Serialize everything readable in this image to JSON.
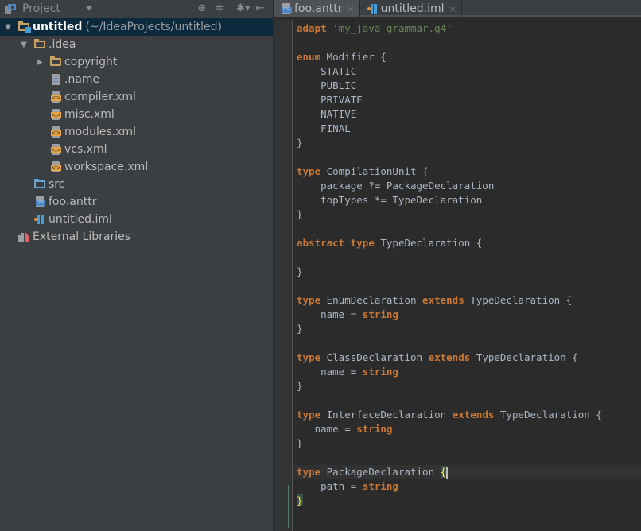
{
  "project_panel": {
    "title": "Project",
    "toolbar_icons": [
      "locate-icon",
      "collapse-all-icon",
      "settings-icon",
      "hide-panel-icon"
    ],
    "tree": [
      {
        "label": "untitled",
        "suffix": "(~/IdeaProjects/untitled)",
        "icon": "module-folder-icon",
        "expanded": true,
        "selected": true,
        "level": 0
      },
      {
        "label": ".idea",
        "icon": "folder-icon",
        "expanded": true,
        "level": 1
      },
      {
        "label": "copyright",
        "icon": "folder-icon",
        "expanded": false,
        "level": 2
      },
      {
        "label": ".name",
        "icon": "text-file-icon",
        "level": 2
      },
      {
        "label": "compiler.xml",
        "icon": "xml-file-icon",
        "level": 2
      },
      {
        "label": "misc.xml",
        "icon": "xml-file-icon",
        "level": 2
      },
      {
        "label": "modules.xml",
        "icon": "xml-file-icon",
        "level": 2
      },
      {
        "label": "vcs.xml",
        "icon": "xml-file-icon",
        "level": 2
      },
      {
        "label": "workspace.xml",
        "icon": "xml-file-icon",
        "level": 2
      },
      {
        "label": "src",
        "icon": "source-folder-icon",
        "level": 1
      },
      {
        "label": "foo.anttr",
        "icon": "dsl-file-icon",
        "level": 1
      },
      {
        "label": "untitled.iml",
        "icon": "iml-file-icon",
        "level": 1
      },
      {
        "label": "External Libraries",
        "icon": "libraries-icon",
        "level": 0
      }
    ]
  },
  "editor": {
    "tabs": [
      {
        "label": "foo.anttr",
        "active": true,
        "close": "×"
      },
      {
        "label": "untitled.iml",
        "active": false,
        "close": "×"
      }
    ],
    "code_lines": [
      [
        {
          "t": "adapt",
          "c": "kw"
        },
        {
          "t": " "
        },
        {
          "t": "'my_java-grammar.g4'",
          "c": "str"
        }
      ],
      [],
      [
        {
          "t": "enum",
          "c": "kw"
        },
        {
          "t": " Modifier {"
        }
      ],
      [
        {
          "t": "    STATIC"
        }
      ],
      [
        {
          "t": "    PUBLIC"
        }
      ],
      [
        {
          "t": "    PRIVATE"
        }
      ],
      [
        {
          "t": "    NATIVE"
        }
      ],
      [
        {
          "t": "    FINAL"
        }
      ],
      [
        {
          "t": "}"
        }
      ],
      [],
      [
        {
          "t": "type",
          "c": "kw"
        },
        {
          "t": " CompilationUnit {"
        }
      ],
      [
        {
          "t": "    package ?= PackageDeclaration"
        }
      ],
      [
        {
          "t": "    topTypes *= TypeDeclaration"
        }
      ],
      [
        {
          "t": "}"
        }
      ],
      [],
      [
        {
          "t": "abstract",
          "c": "kw"
        },
        {
          "t": " "
        },
        {
          "t": "type",
          "c": "kw"
        },
        {
          "t": " TypeDeclaration {"
        }
      ],
      [],
      [
        {
          "t": "}"
        }
      ],
      [],
      [
        {
          "t": "type",
          "c": "kw"
        },
        {
          "t": " EnumDeclaration "
        },
        {
          "t": "extends",
          "c": "kw"
        },
        {
          "t": " TypeDeclaration {"
        }
      ],
      [
        {
          "t": "    name = "
        },
        {
          "t": "string",
          "c": "kw"
        }
      ],
      [
        {
          "t": "}"
        }
      ],
      [],
      [
        {
          "t": "type",
          "c": "kw"
        },
        {
          "t": " ClassDeclaration "
        },
        {
          "t": "extends",
          "c": "kw"
        },
        {
          "t": " TypeDeclaration {"
        }
      ],
      [
        {
          "t": "    name = "
        },
        {
          "t": "string",
          "c": "kw"
        }
      ],
      [
        {
          "t": "}"
        }
      ],
      [],
      [
        {
          "t": "type",
          "c": "kw"
        },
        {
          "t": " InterfaceDeclaration "
        },
        {
          "t": "extends",
          "c": "kw"
        },
        {
          "t": " TypeDeclaration {"
        }
      ],
      [
        {
          "t": "   name = "
        },
        {
          "t": "string",
          "c": "kw"
        }
      ],
      [
        {
          "t": "}"
        }
      ],
      [],
      [
        {
          "t": "type",
          "c": "kw"
        },
        {
          "t": " PackageDeclaration "
        },
        {
          "t": "{",
          "c": "brace-hl"
        },
        {
          "t": "",
          "c": "caret"
        }
      ],
      [
        {
          "t": "    path = "
        },
        {
          "t": "string",
          "c": "kw"
        }
      ],
      [
        {
          "t": "}",
          "c": "brace-hl"
        }
      ]
    ],
    "current_line_index": 31
  },
  "colors": {
    "keyword": "#cc7832",
    "string": "#6a8759",
    "identifier": "#a9b7c6",
    "selection": "#0d293e",
    "brace_match_bg": "#3b514d",
    "brace_match_fg": "#ffef28"
  }
}
